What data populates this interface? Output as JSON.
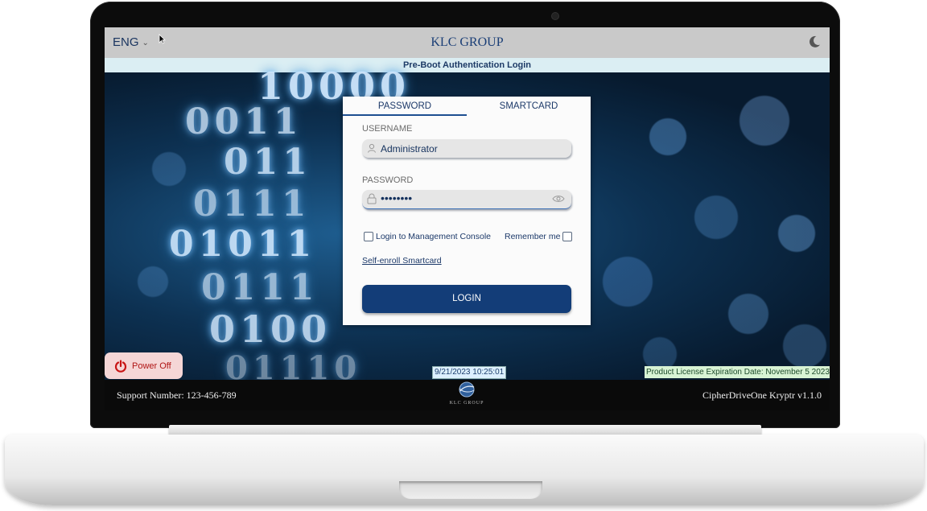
{
  "topbar": {
    "language": "ENG",
    "brand": "KLC GROUP",
    "theme_icon": "moon-icon"
  },
  "subbar": {
    "title": "Pre-Boot Authentication Login"
  },
  "background": {
    "digits": [
      "10000",
      "0011",
      "011",
      "0111",
      "01011",
      "0111",
      "0100",
      "01110"
    ]
  },
  "login": {
    "tabs": [
      {
        "label": "PASSWORD",
        "active": true
      },
      {
        "label": "SMARTCARD",
        "active": false
      }
    ],
    "username_label": "USERNAME",
    "username_value": "Administrator",
    "password_label": "PASSWORD",
    "password_value": "••••••••",
    "management_console_label": "Login to Management Console",
    "management_console_checked": false,
    "remember_me_label": "Remember me",
    "remember_me_checked": false,
    "self_enroll_label": "Self-enroll Smartcard",
    "login_button": "LOGIN"
  },
  "power_button": "Power Off",
  "datetime": "9/21/2023 10:25:01",
  "license": "Product License Expiration Date: November 5 2023",
  "footer": {
    "support": "Support Number: 123-456-789",
    "logo_text": "KLC GROUP",
    "product": "CipherDriveOne Kryptr v1.1.0"
  },
  "colors": {
    "accent": "#133d78",
    "topbar": "#c9c9c9",
    "subbar": "#dbeef3",
    "power_bg": "#f5d6d6",
    "power_fg": "#b01515",
    "license_bg": "#d8f3d4"
  }
}
